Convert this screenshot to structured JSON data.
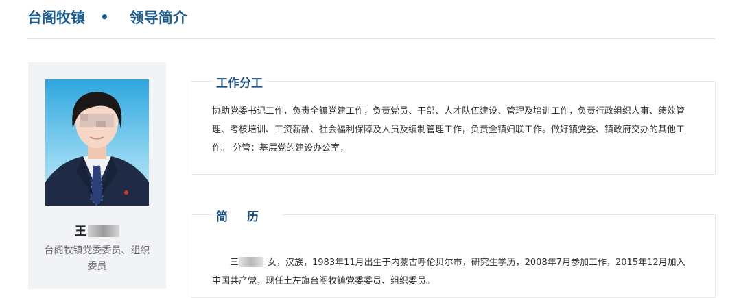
{
  "header": {
    "town": "台阁牧镇",
    "separator": "•",
    "page": "领导简介"
  },
  "profile": {
    "name_visible": "王",
    "role": "台阁牧镇党委委员、组织委员"
  },
  "work_section": {
    "heading": "工作分工",
    "text": "协助党委书记工作，负责全镇党建工作，负责党员、干部、人才队伍建设、管理及培训工作，负责行政组织人事、绩效管理、考核培训、工资薪酬、社会福利保障及人员及编制管理工作，负责全镇妇联工作。做好镇党委、镇政府交办的其他工作。 分管：基层党的建设办公室，"
  },
  "resume_section": {
    "heading": "简历",
    "text_visible_prefix": "三",
    "text": "女，汉族，1983年11月出生于内蒙古呼伦贝尔市，研究生学历，2008年7月参加工作，2015年12月加入中国共产党，现任土左旗台阁牧镇党委委员、组织委员。"
  },
  "colors": {
    "title": "#1b5c8f",
    "section_heading": "#1b4f80",
    "card_bg": "#f1f3f6"
  }
}
